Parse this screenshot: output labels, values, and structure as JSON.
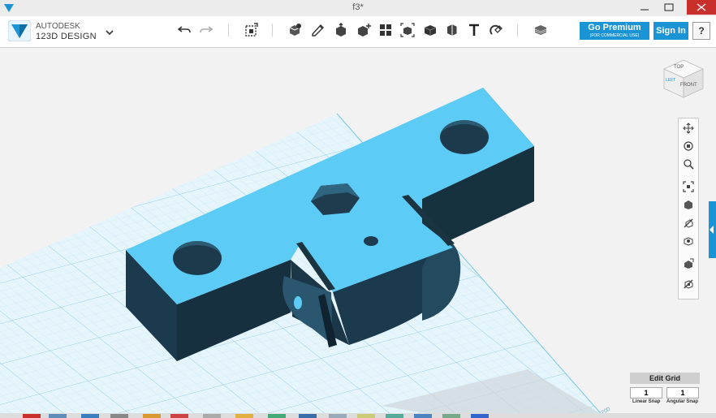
{
  "window": {
    "title": "f3*"
  },
  "brand": {
    "line1": "AUTODESK",
    "line2": "123D DESIGN",
    "menu_icon": "chevron-down-icon"
  },
  "toolbar": {
    "tools": [
      "undo-icon",
      "redo-icon",
      "transform-icon",
      "primitives-icon",
      "sketch-icon",
      "construct-icon",
      "modify-icon",
      "pattern-icon",
      "grouping-icon",
      "combine-icon",
      "measure-icon",
      "text-icon",
      "snap-icon",
      "material-icon"
    ],
    "premium_label": "Go Premium",
    "premium_sub": "(FOR COMMERCIAL USE)",
    "signin_label": "Sign In",
    "help_label": "?"
  },
  "viewcube": {
    "top": "TOP",
    "front": "FRONT",
    "left": "LEFT"
  },
  "navigation": [
    "pan-icon",
    "orbit-icon",
    "zoom-icon",
    "fit-icon",
    "view-icon",
    "visibility-icon",
    "material-view-icon",
    "grid-icon",
    "snap-view-icon"
  ],
  "grid_controls": {
    "edit_label": "Edit Grid",
    "linear_value": "1",
    "linear_label": "Linear Snap",
    "angular_value": "1",
    "angular_label": "Angular Snap"
  },
  "grid": {
    "corner_label": "200"
  },
  "colors": {
    "accent": "#1a94d4",
    "part_top": "#5ccbf5",
    "part_side": "#1a3a4e",
    "grid_line": "#a9d9f0"
  }
}
